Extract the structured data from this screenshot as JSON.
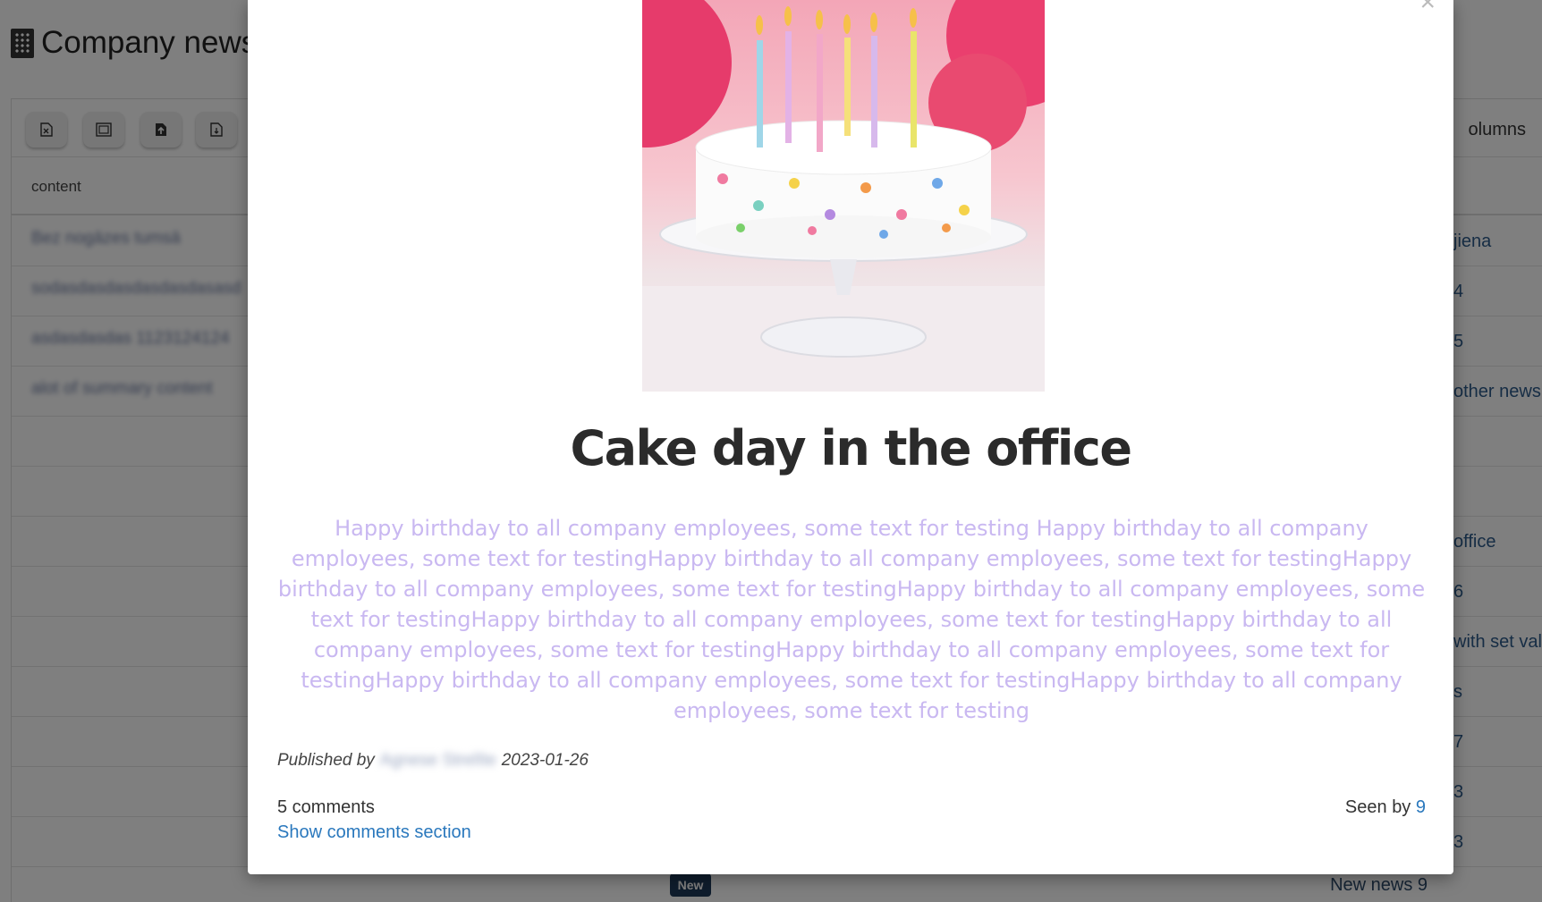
{
  "page": {
    "title": "Company news",
    "columns_label": "olumns",
    "header_content": "content"
  },
  "rows": [
    {
      "left": "Bez nogāzes tumsā",
      "right": "jiena"
    },
    {
      "left": "sodasdasdasdasdasdasasd",
      "right": "4"
    },
    {
      "left": "asdasdasdas 1123124124",
      "right": "5"
    },
    {
      "left": "alot of summary content",
      "right": "other news"
    },
    {
      "left": "",
      "right": ""
    },
    {
      "left": "",
      "right": ""
    },
    {
      "left": "",
      "right": "office"
    },
    {
      "left": "",
      "right": "6"
    },
    {
      "left": "",
      "right": "with set val"
    },
    {
      "left": "",
      "right": "s"
    },
    {
      "left": "",
      "right": "7"
    },
    {
      "left": "",
      "right": "3"
    },
    {
      "left": "",
      "right": "3"
    }
  ],
  "last_row": {
    "badge": "New",
    "right": "New news 9"
  },
  "modal": {
    "close": "×",
    "title": "Cake day in the office",
    "body": "Happy birthday to all company employees, some text for testing Happy birthday to all company employees, some text for testingHappy birthday to all company employees, some text for testingHappy birthday to all company employees, some text for testingHappy birthday to all company employees, some text for testingHappy birthday to all company employees, some text for testingHappy birthday to all company employees, some text for testingHappy birthday to all company employees, some text for testingHappy birthday to all company employees, some text for testingHappy birthday to all company employees, some text for testing",
    "published_label": "Published by",
    "author": "Agnese Strelīte",
    "date": "2023-01-26",
    "comments_count": "5 comments",
    "show_comments": "Show comments section",
    "seen_by_label": "Seen by",
    "seen_by_count": "9"
  },
  "colors": {
    "accent_link": "#2a78bd",
    "body_text": "#c9b8f1",
    "badge_bg": "#1f3a5a"
  },
  "icons": {
    "toolbar": [
      "excel-export-icon",
      "image-export-icon",
      "file-upload-icon",
      "file-download-icon"
    ]
  }
}
